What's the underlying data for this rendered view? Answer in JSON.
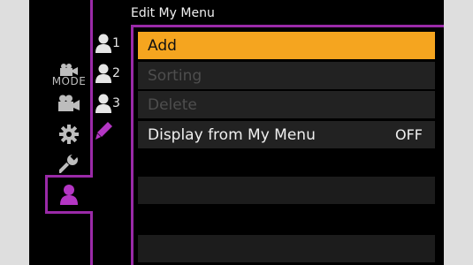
{
  "header": {
    "title": "Edit My Menu"
  },
  "left_tabs": [
    {
      "icon": "creative-video-mode-icon",
      "label": "MODE"
    },
    {
      "icon": "movie-camera-icon"
    },
    {
      "icon": "gear-icon"
    },
    {
      "icon": "wrench-icon"
    },
    {
      "icon": "my-menu-person-icon",
      "selected": true
    }
  ],
  "sub_tabs": [
    {
      "icon": "person-icon",
      "num": "1"
    },
    {
      "icon": "person-icon",
      "num": "2"
    },
    {
      "icon": "person-icon",
      "num": "3"
    },
    {
      "icon": "pencil-icon",
      "selected": true
    }
  ],
  "menu": {
    "items": [
      {
        "label": "Add",
        "state": "selected"
      },
      {
        "label": "Sorting",
        "state": "disabled"
      },
      {
        "label": "Delete",
        "state": "disabled"
      },
      {
        "label": "Display from My Menu",
        "value": "OFF",
        "state": "normal"
      }
    ]
  },
  "colors": {
    "accent_purple": "#9a2aa8",
    "selected_orange": "#f5a51f",
    "row_bg": "#222222",
    "disabled_text": "#4e4e4e"
  }
}
